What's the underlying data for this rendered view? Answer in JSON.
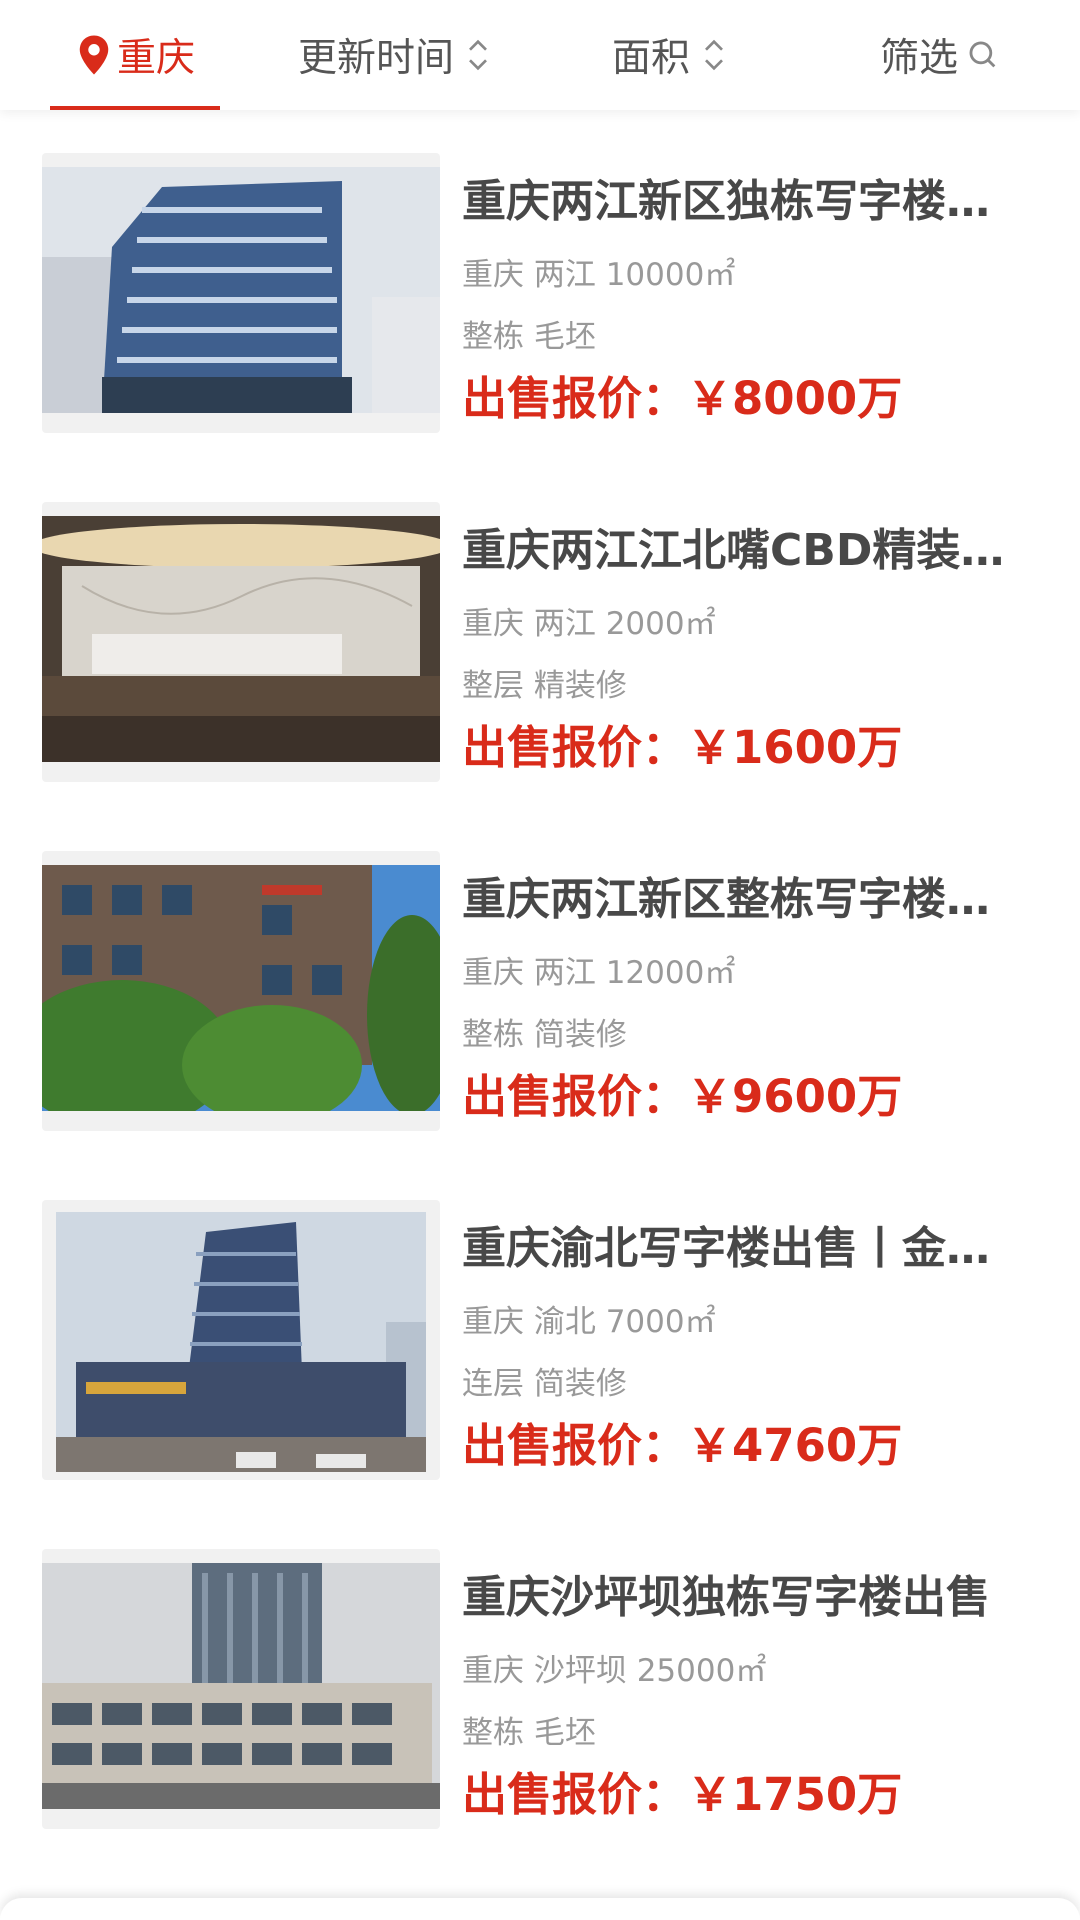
{
  "filter_bar": {
    "city": "重庆",
    "update_time": "更新时间",
    "area": "面积",
    "filter": "筛选"
  },
  "listings": [
    {
      "title": "重庆两江新区独栋写字楼出售",
      "location": "重庆 两江 10000㎡",
      "type": "整栋 毛坯",
      "price": "出售报价：￥8000万"
    },
    {
      "title": "重庆两江江北嘴CBD精装修写字楼出售",
      "location": "重庆 两江 2000㎡",
      "type": "整层 精装修",
      "price": "出售报价：￥1600万"
    },
    {
      "title": "重庆两江新区整栋写字楼出售",
      "location": "重庆 两江 12000㎡",
      "type": "整栋 简装修",
      "price": "出售报价：￥9600万"
    },
    {
      "title": "重庆渝北写字楼出售丨金融中心",
      "location": "重庆 渝北 7000㎡",
      "type": "连层 简装修",
      "price": "出售报价：￥4760万"
    },
    {
      "title": "重庆沙坪坝独栋写字楼出售",
      "location": "重庆 沙坪坝 25000㎡",
      "type": "整栋 毛坯",
      "price": "出售报价：￥1750万"
    }
  ],
  "colors": {
    "accent": "#d92b1a",
    "title": "#484848",
    "meta": "#999999"
  },
  "icons": {
    "location": "location-pin-icon",
    "sort": "sort-updown-icon",
    "search": "search-icon"
  }
}
